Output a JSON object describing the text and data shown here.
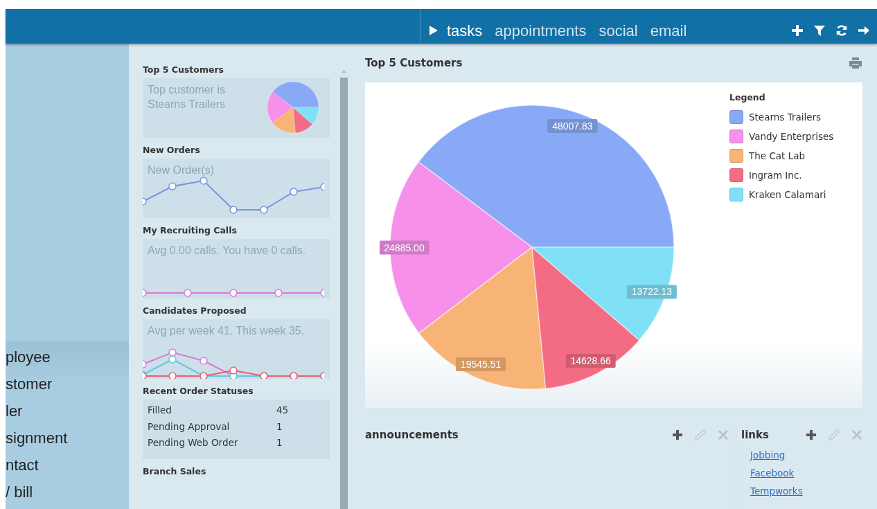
{
  "header": {
    "tabs": [
      {
        "label": "tasks",
        "selected": true
      },
      {
        "label": "appointments",
        "selected": false
      },
      {
        "label": "social",
        "selected": false
      },
      {
        "label": "email",
        "selected": false
      }
    ]
  },
  "left_nav": {
    "items": [
      "ployee",
      "stomer",
      "ler",
      "signment",
      "ntact",
      "/ bill"
    ]
  },
  "sidebar": {
    "widgets": [
      {
        "kind": "pie",
        "title": "Top 5 Customers",
        "text": "Top customer is Stearns Trailers"
      },
      {
        "kind": "line",
        "title": "New Orders",
        "text": "New Order(s)"
      },
      {
        "kind": "line",
        "title": "My Recruiting Calls",
        "text": "Avg 0.00 calls. You have 0 calls."
      },
      {
        "kind": "line",
        "title": "Candidates Proposed",
        "text": "Avg per week 41. This week 35."
      },
      {
        "kind": "table",
        "title": "Recent Order Statuses",
        "rows": [
          {
            "label": "Filled",
            "value": "45"
          },
          {
            "label": "Pending Approval",
            "value": "1"
          },
          {
            "label": "Pending Web Order",
            "value": "1"
          }
        ]
      },
      {
        "kind": "heading",
        "title": "Branch Sales"
      }
    ]
  },
  "main": {
    "title": "Top 5 Customers",
    "chart_data": {
      "type": "pie",
      "categories": [
        "Stearns Trailers",
        "Vandy Enterprises",
        "The Cat Lab",
        "Ingram Inc.",
        "Kraken Calamari"
      ],
      "values": [
        48007.83,
        24885.0,
        19545.51,
        14628.66,
        13722.13
      ],
      "colors": [
        "#88aaf6",
        "#f690ea",
        "#f8b476",
        "#f46c84",
        "#80e0f6"
      ],
      "value_labels": [
        "48007.83",
        "24885.00",
        "19545.51",
        "14628.66",
        "13722.13"
      ],
      "legend": {
        "title": "Legend"
      }
    }
  },
  "announcements": {
    "title": "announcements"
  },
  "links": {
    "title": "links",
    "items": [
      "Jobbing",
      "Facebook",
      "Tempworks"
    ]
  }
}
